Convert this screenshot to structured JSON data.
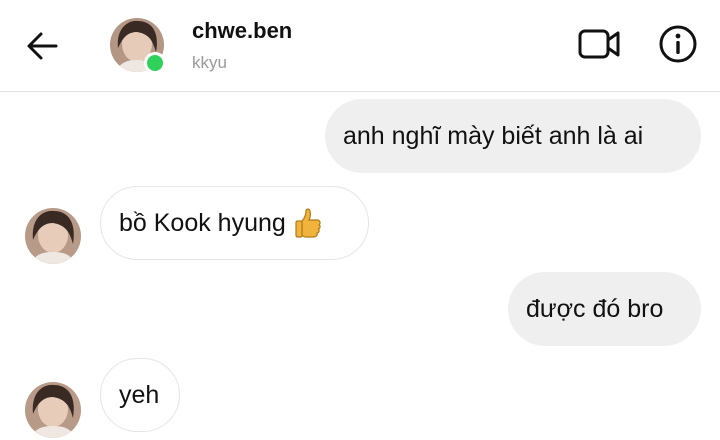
{
  "header": {
    "user_name": "chwe.ben",
    "user_subtitle": "kkyu",
    "online_color": "#2fd15a",
    "icons": [
      "back-arrow-icon",
      "video-camera-icon",
      "info-icon"
    ]
  },
  "messages": [
    {
      "direction": "outgoing",
      "text": "anh nghĩ mày biết anh là ai"
    },
    {
      "direction": "incoming",
      "text": "bồ Kook hyung",
      "emoji": "thumbs-up"
    },
    {
      "direction": "outgoing",
      "text": "được đó bro"
    },
    {
      "direction": "incoming",
      "text": "yeh"
    }
  ]
}
